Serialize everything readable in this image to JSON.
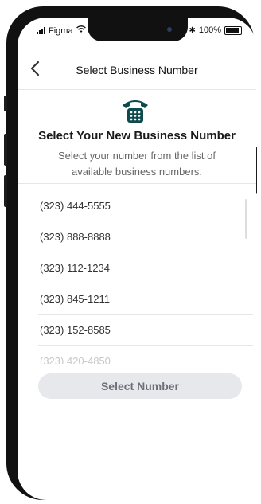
{
  "status_bar": {
    "carrier": "Figma",
    "battery": "100%"
  },
  "header": {
    "title": "Select Business Number"
  },
  "intro": {
    "heading": "Select Your New Business Number",
    "subtext": "Select your number from the list of available business numbers."
  },
  "numbers": [
    "(323) 444-5555",
    "(323) 888-8888",
    "(323) 112-1234",
    "(323) 845-1211",
    "(323) 152-8585",
    "(323) 420-4850"
  ],
  "actions": {
    "select_label": "Select Number"
  },
  "colors": {
    "icon": "#0f4b4e",
    "button_bg": "#e7e8eb",
    "button_text": "#6b6f77"
  }
}
